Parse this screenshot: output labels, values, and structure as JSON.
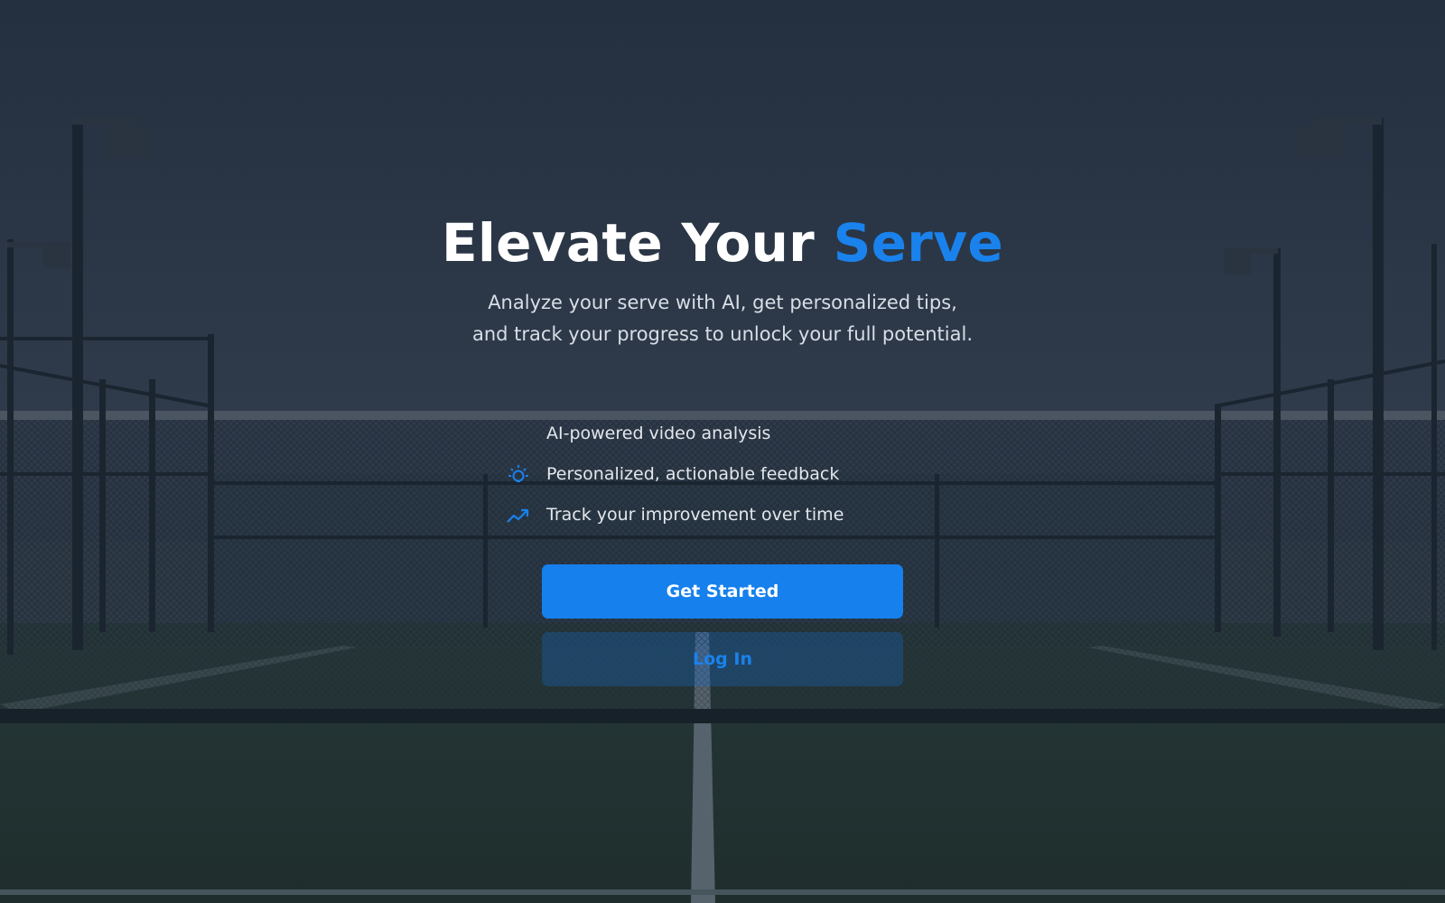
{
  "hero": {
    "title_main": "Elevate Your ",
    "title_accent": "Serve",
    "subtitle": "Analyze your serve with AI, get personalized tips, and track your progress to unlock your full potential."
  },
  "features": [
    {
      "label": "AI-powered video analysis",
      "icon": "video-icon"
    },
    {
      "label": "Personalized, actionable feedback",
      "icon": "lightbulb-icon"
    },
    {
      "label": "Track your improvement over time",
      "icon": "trending-up-icon"
    }
  ],
  "actions": {
    "primary_label": "Get Started",
    "secondary_label": "Log In"
  },
  "colors": {
    "accent": "#1a82ec",
    "primary_button": "#1680ec",
    "text_light": "#e3e7ec",
    "overlay": "#243241"
  }
}
